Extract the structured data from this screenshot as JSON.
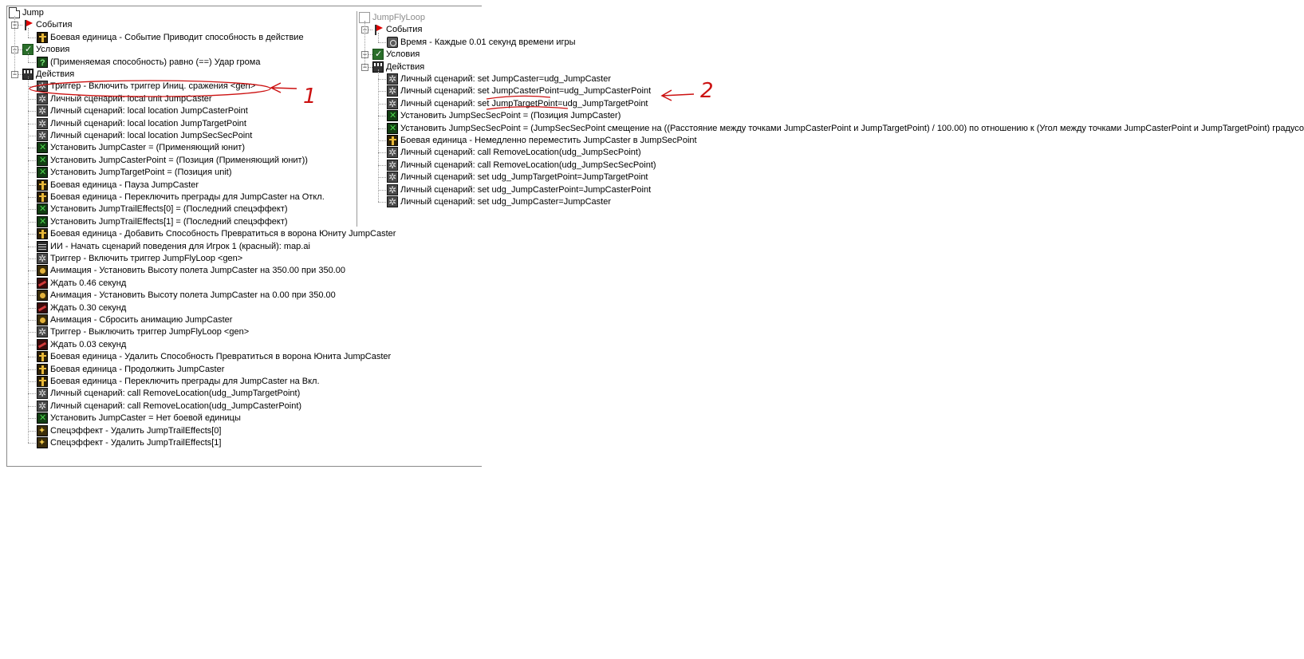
{
  "left": {
    "title": "Jump",
    "events_label": "События",
    "events": [
      {
        "icon": "unit-icon",
        "text": "Боевая единица - Событие Приводит способность в действие"
      }
    ],
    "conditions_label": "Условия",
    "conditions": [
      {
        "icon": "condition-question-icon",
        "text": "(Применяемая способность) равно (==) Удар грома"
      }
    ],
    "actions_label": "Действия",
    "actions": [
      {
        "icon": "trigger-gear-icon",
        "text": "Триггер - Включить триггер Иниц. сражения <gen>"
      },
      {
        "icon": "script-gear-icon",
        "text": "Личный сценарий:   local unit JumpCaster"
      },
      {
        "icon": "script-gear-icon",
        "text": "Личный сценарий:   local location JumpCasterPoint"
      },
      {
        "icon": "script-gear-icon",
        "text": "Личный сценарий:   local location JumpTargetPoint"
      },
      {
        "icon": "script-gear-icon",
        "text": "Личный сценарий:   local location JumpSecSecPoint"
      },
      {
        "icon": "set-variable-icon",
        "text": "Установить JumpCaster = (Применяющий юнит)"
      },
      {
        "icon": "set-variable-icon",
        "text": "Установить JumpCasterPoint = (Позиция (Применяющий юнит))"
      },
      {
        "icon": "set-variable-icon",
        "text": "Установить JumpTargetPoint = (Позиция unit)"
      },
      {
        "icon": "unit-icon",
        "text": "Боевая единица - Пауза JumpCaster"
      },
      {
        "icon": "unit-icon",
        "text": "Боевая единица - Переключить преграды для JumpCaster на Откл."
      },
      {
        "icon": "set-variable-icon",
        "text": "Установить JumpTrailEffects[0] = (Последний спецэффект)"
      },
      {
        "icon": "set-variable-icon",
        "text": "Установить JumpTrailEffects[1] = (Последний спецэффект)"
      },
      {
        "icon": "unit-icon",
        "text": "Боевая единица - Добавить Способность Превратиться в ворона Юниту JumpCaster"
      },
      {
        "icon": "ai-icon",
        "text": "ИИ - Начать сценарий поведения для Игрок 1 (красный): map.ai"
      },
      {
        "icon": "trigger-gear-icon",
        "text": "Триггер - Включить триггер JumpFlyLoop <gen>"
      },
      {
        "icon": "animation-icon",
        "text": "Анимация - Установить Высоту полета JumpCaster на 350.00 при 350.00"
      },
      {
        "icon": "wait-icon",
        "text": "Ждать 0.46 секунд"
      },
      {
        "icon": "animation-icon",
        "text": "Анимация - Установить Высоту полета JumpCaster на 0.00 при 350.00"
      },
      {
        "icon": "wait-icon",
        "text": "Ждать 0.30 секунд"
      },
      {
        "icon": "animation-icon",
        "text": "Анимация - Сбросить анимацию JumpCaster"
      },
      {
        "icon": "trigger-gear-icon",
        "text": "Триггер - Выключить триггер JumpFlyLoop <gen>"
      },
      {
        "icon": "wait-icon",
        "text": "Ждать 0.03 секунд"
      },
      {
        "icon": "unit-icon",
        "text": "Боевая единица - Удалить Способность Превратиться в ворона Юнита JumpCaster"
      },
      {
        "icon": "unit-icon",
        "text": "Боевая единица - Продолжить JumpCaster"
      },
      {
        "icon": "unit-icon",
        "text": "Боевая единица - Переключить преграды для JumpCaster на Вкл."
      },
      {
        "icon": "script-gear-icon",
        "text": "Личный сценарий:   call RemoveLocation(udg_JumpTargetPoint)"
      },
      {
        "icon": "script-gear-icon",
        "text": "Личный сценарий:   call RemoveLocation(udg_JumpCasterPoint)"
      },
      {
        "icon": "set-variable-icon",
        "text": "Установить JumpCaster = Нет боевой единицы"
      },
      {
        "icon": "effect-icon",
        "text": "Спецэффект - Удалить JumpTrailEffects[0]"
      },
      {
        "icon": "effect-icon",
        "text": "Спецэффект - Удалить JumpTrailEffects[1]"
      }
    ]
  },
  "right": {
    "title": "JumpFlyLoop",
    "events_label": "События",
    "events": [
      {
        "icon": "timer-icon",
        "text": "Время - Каждые 0.01 секунд времени игры"
      }
    ],
    "conditions_label": "Условия",
    "actions_label": "Действия",
    "actions": [
      {
        "icon": "script-gear-icon",
        "text": "Личный сценарий:   set JumpCaster=udg_JumpCaster"
      },
      {
        "icon": "script-gear-icon",
        "text": "Личный сценарий:   set JumpCasterPoint=udg_JumpCasterPoint"
      },
      {
        "icon": "script-gear-icon",
        "text": "Личный сценарий:   set JumpTargetPoint=udg_JumpTargetPoint"
      },
      {
        "icon": "set-variable-icon",
        "text": "Установить JumpSecSecPoint = (Позиция JumpCaster)"
      },
      {
        "icon": "set-variable-icon",
        "text": "Установить JumpSecSecPoint = (JumpSecSecPoint смещение на ((Расстояние между точками JumpCasterPoint и JumpTargetPoint) / 100.00) по отношению к (Угол между точками JumpCasterPoint и JumpTargetPoint) градусов)"
      },
      {
        "icon": "unit-icon",
        "text": "Боевая единица - Немедленно переместить JumpCaster в JumpSecPoint"
      },
      {
        "icon": "script-gear-icon",
        "text": "Личный сценарий:   call RemoveLocation(udg_JumpSecPoint)"
      },
      {
        "icon": "script-gear-icon",
        "text": "Личный сценарий:   call RemoveLocation(udg_JumpSecSecPoint)"
      },
      {
        "icon": "script-gear-icon",
        "text": "Личный сценарий:   set udg_JumpTargetPoint=JumpTargetPoint"
      },
      {
        "icon": "script-gear-icon",
        "text": "Личный сценарий:   set udg_JumpCasterPoint=JumpCasterPoint"
      },
      {
        "icon": "script-gear-icon",
        "text": "Личный сценарий:   set udg_JumpCaster=JumpCaster"
      }
    ]
  },
  "annotations": {
    "note1": "1",
    "note2": "2"
  },
  "colors": {
    "annotation_red": "#cc1111",
    "title_gray": "#8c8c8c"
  }
}
